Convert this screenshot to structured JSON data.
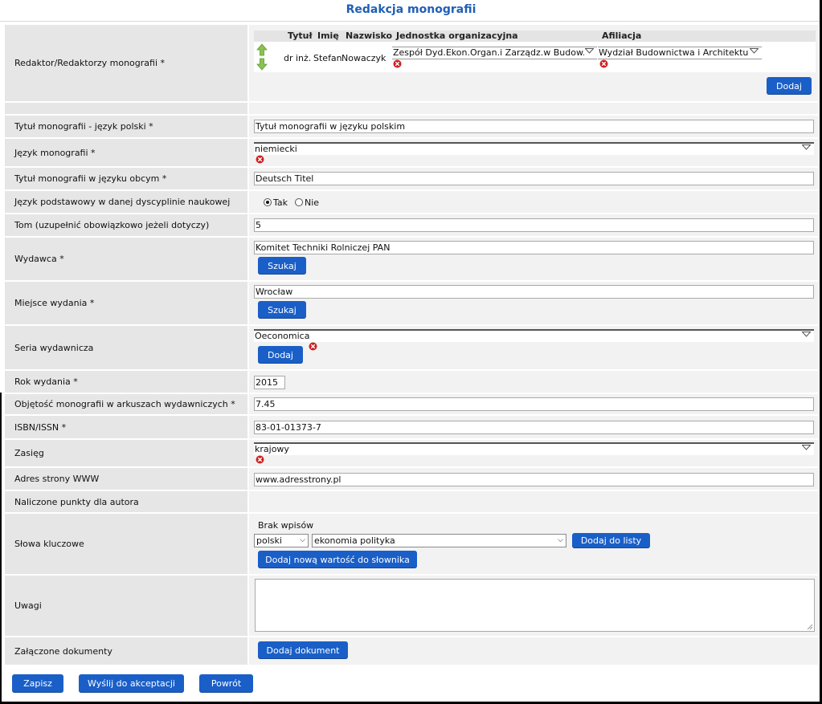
{
  "page_title": "Redakcja monografii",
  "editors": {
    "label": "Redaktor/Redaktorzy monografii *",
    "columns": [
      "Tytuł",
      "Imię",
      "Nazwisko",
      "Jednostka organizacyjna",
      "Afiliacja"
    ],
    "rows": [
      {
        "title": "dr inż.",
        "first_name": "Stefan",
        "last_name": "Nowaczyk",
        "unit": "Zespół Dyd.Ekon.Organ.i Zarządz.w Budow. W",
        "affiliation": "Wydział Budownictwa i Architektury"
      }
    ],
    "add_button": "Dodaj"
  },
  "fields": {
    "title_pl": {
      "label": "Tytuł monografii - język polski *",
      "value": "Tytuł monografii w języku polskim"
    },
    "language": {
      "label": "Język monografii *",
      "value": "niemiecki"
    },
    "title_foreign": {
      "label": "Tytuł monografii w języku obcym *",
      "value": "Deutsch Titel"
    },
    "base_language": {
      "label": "Język podstawowy w danej dyscyplinie naukowej",
      "option_yes": "Tak",
      "option_no": "Nie",
      "selected": "Tak"
    },
    "volume": {
      "label": "Tom (uzupełnić obowiązkowo jeżeli dotyczy)",
      "value": "5"
    },
    "publisher": {
      "label": "Wydawca *",
      "value": "Komitet Techniki Rolniczej PAN",
      "button": "Szukaj"
    },
    "place": {
      "label": "Miejsce wydania *",
      "value": "Wrocław",
      "button": "Szukaj"
    },
    "series": {
      "label": "Seria wydawnicza",
      "value": "Oeconomica",
      "button": "Dodaj"
    },
    "year": {
      "label": "Rok wydania *",
      "value": "2015"
    },
    "volume_sheets": {
      "label": "Objętość monografii w arkuszach wydawniczych *",
      "value": "7.45"
    },
    "isbn": {
      "label": "ISBN/ISSN *",
      "value": "83-01-01373-7"
    },
    "scope": {
      "label": "Zasięg",
      "value": "krajowy"
    },
    "www": {
      "label": "Adres strony WWW",
      "value": "www.adresstrony.pl"
    },
    "points": {
      "label": "Naliczone punkty dla autora"
    },
    "keywords": {
      "label": "Słowa kluczowe",
      "empty_text": "Brak wpisów",
      "lang_value": "polski",
      "keyword_value": "ekonomia polityka",
      "add_to_list": "Dodaj do listy",
      "add_new": "Dodaj nową wartość do słownika"
    },
    "notes": {
      "label": "Uwagi",
      "value": ""
    },
    "attachments": {
      "label": "Załączone dokumenty",
      "button": "Dodaj dokument"
    }
  },
  "footer": {
    "save": "Zapisz",
    "send": "Wyślij do akceptacji",
    "back": "Powrót"
  },
  "colors": {
    "accent": "#1a5fc8",
    "title": "#1f5fb5",
    "delete": "#cc2222",
    "arrow": "#7ab648"
  }
}
